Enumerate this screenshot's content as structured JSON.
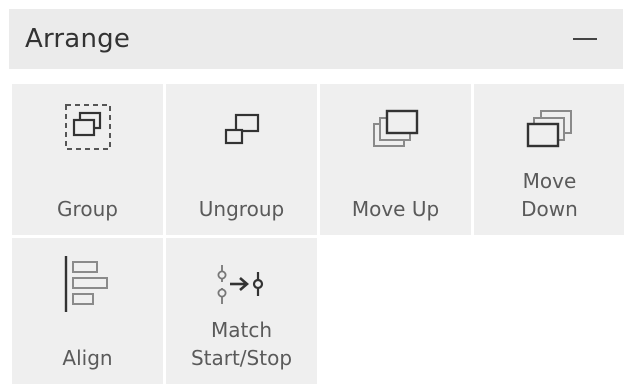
{
  "panel": {
    "title": "Arrange",
    "collapse_icon": "minus-icon"
  },
  "tiles": [
    {
      "label": "Group",
      "icon": "group-icon"
    },
    {
      "label": "Ungroup",
      "icon": "ungroup-icon"
    },
    {
      "label": "Move Up",
      "icon": "move-up-icon"
    },
    {
      "label": "Move\nDown",
      "icon": "move-down-icon"
    },
    {
      "label": "Align",
      "icon": "align-icon"
    },
    {
      "label": "Match\nStart/Stop",
      "icon": "match-start-stop-icon"
    }
  ],
  "colors": {
    "header_bg": "#ebebeb",
    "tile_bg": "#efefef",
    "text": "#5a5a5a",
    "icon_dark": "#333333",
    "icon_light": "#8a8a8a"
  }
}
